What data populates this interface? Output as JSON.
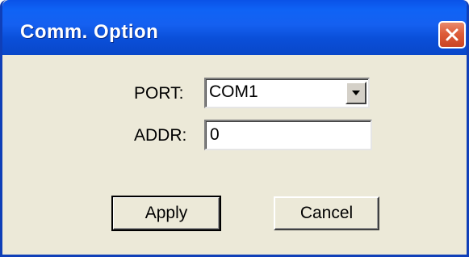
{
  "window": {
    "title": "Comm. Option"
  },
  "icons": {
    "close": "close-icon",
    "dropdown": "chevron-down-icon"
  },
  "form": {
    "port_label": "PORT:",
    "port_value": "COM1",
    "addr_label": "ADDR:",
    "addr_value": "0"
  },
  "buttons": {
    "apply_label": "Apply",
    "cancel_label": "Cancel"
  },
  "colors": {
    "titlebar": "#0a52e7",
    "close_button": "#de5d3a",
    "dialog_background": "#ece9d8"
  }
}
